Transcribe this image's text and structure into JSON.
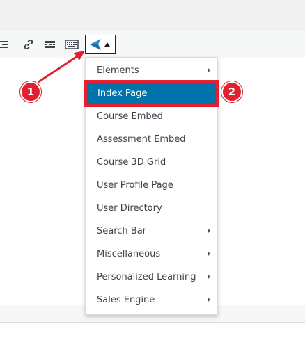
{
  "toolbar": {
    "buttons": [
      {
        "name": "align-right-icon"
      },
      {
        "name": "link-icon"
      },
      {
        "name": "horizontal-line-icon"
      },
      {
        "name": "keyboard-icon"
      }
    ],
    "shortcode_button": {
      "icon": "blue-arrow-icon",
      "dropdown_icon": "caret-up-icon"
    }
  },
  "menu": {
    "items": [
      {
        "label": "Elements",
        "has_submenu": true
      },
      {
        "label": "Index Page",
        "has_submenu": false,
        "active": true
      },
      {
        "label": "Course Embed",
        "has_submenu": false
      },
      {
        "label": "Assessment Embed",
        "has_submenu": false
      },
      {
        "label": "Course 3D Grid",
        "has_submenu": false
      },
      {
        "label": "User Profile Page",
        "has_submenu": false
      },
      {
        "label": "User Directory",
        "has_submenu": false
      },
      {
        "label": "Search Bar",
        "has_submenu": true
      },
      {
        "label": "Miscellaneous",
        "has_submenu": true
      },
      {
        "label": "Personalized Learning",
        "has_submenu": true
      },
      {
        "label": "Sales Engine",
        "has_submenu": true
      }
    ]
  },
  "callouts": {
    "step1": "1",
    "step2": "2"
  },
  "colors": {
    "accent_blue": "#0073aa",
    "highlight_red": "#e3202f",
    "arrow_blue": "#2a8fd6"
  }
}
